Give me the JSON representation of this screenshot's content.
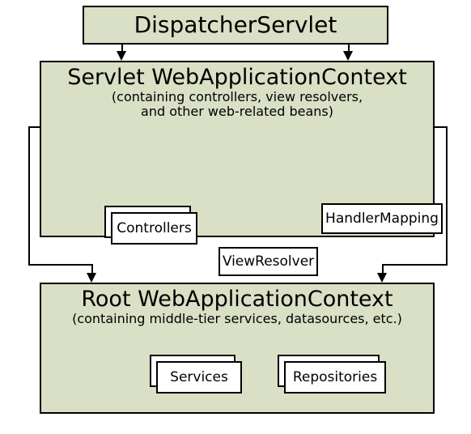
{
  "dispatcher": {
    "title": "DispatcherServlet"
  },
  "servletCtx": {
    "title": "Servlet WebApplicationContext",
    "sub1": "(containing controllers, view resolvers,",
    "sub2": "and other web-related beans)",
    "controllers": "Controllers",
    "viewResolver": "ViewResolver",
    "handlerMapping": "HandlerMapping"
  },
  "rootCtx": {
    "title": "Root WebApplicationContext",
    "sub": "(containing middle-tier services, datasources, etc.)",
    "services": "Services",
    "repositories": "Repositories"
  }
}
